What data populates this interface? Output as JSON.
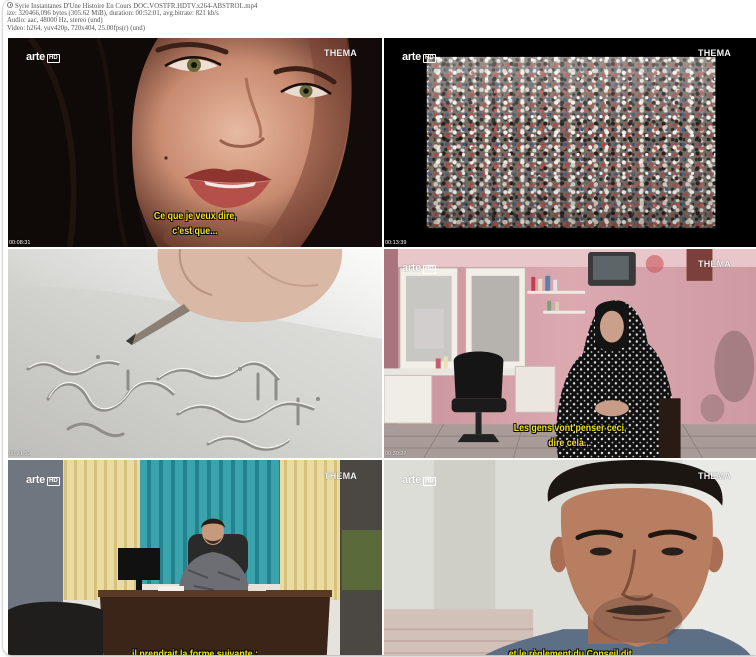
{
  "file_info": {
    "icon": "info-icon",
    "title_line": "Syrie Instantanes D'Une Histoire En Cours DOC.VOSTFR.HDTV.x264-ABSTROL.mp4",
    "size_line": "ize: 320466,096 bytes (305.62 MiB), duration: 00:52:01, avg.bitrate: 821 kb/s",
    "audio_line": "Audio: aac, 48000 Hz, stereo (und)",
    "video_line": "Video: h264, yuv420p, 720x404, 25.00fps(r) (und)"
  },
  "branding": {
    "channel_logo": "arte",
    "channel_badge": "HD",
    "program_logo": "THEMA"
  },
  "frames": [
    {
      "timestamp": "00:08:31",
      "subtitles": [
        "Ce que je veux dire,",
        "c'est que..."
      ]
    },
    {
      "timestamp": "00:13:39",
      "subtitles": []
    },
    {
      "timestamp": "00:21:51",
      "subtitles": []
    },
    {
      "timestamp": "00:30:27",
      "subtitles": [
        "Les gens vont penser ceci,",
        "dire cela..."
      ]
    },
    {
      "subtitles": [
        "il prendrait la forme suivante :"
      ]
    },
    {
      "subtitles": [
        "et le règlement du Conseil dit"
      ]
    }
  ],
  "colors": {
    "subtitle": "#f3e320",
    "header_text": "#555555",
    "timestamp": "#ffffff"
  }
}
